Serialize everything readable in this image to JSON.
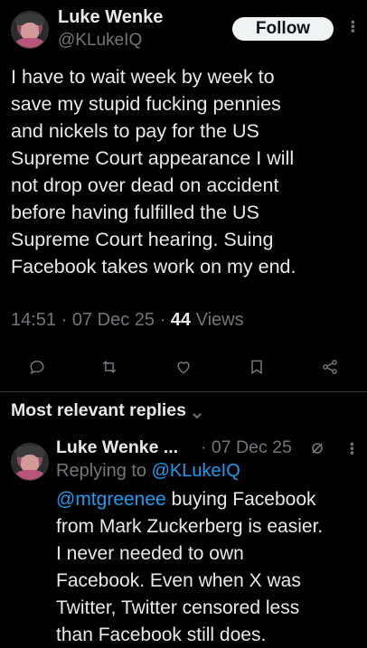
{
  "tweet": {
    "display_name": "Luke Wenke",
    "handle": "@KLukeIQ",
    "follow_label": "Follow",
    "text": "I have to wait week by week to\nsave my stupid fucking pennies\nand nickels to pay for the US\nSupreme Court appearance I will\nnot drop over dead on accident\nbefore having fulfilled the US\nSupreme Court hearing.  Suing\nFacebook takes work on my end.",
    "time": "14:51",
    "sep1": " · ",
    "date": "07 Dec 25",
    "sep2": " · ",
    "views_count": "44",
    "views_label": " Views"
  },
  "actions": [
    "reply-icon",
    "repost-icon",
    "like-icon",
    "bookmark-icon",
    "share-icon"
  ],
  "replies_section": {
    "title": "Most relevant replies"
  },
  "reply": {
    "display_name": "Luke Wenke ...",
    "date": "· 07 Dec 25",
    "replying_prefix": "Replying to ",
    "replying_to": "@KLukeIQ",
    "mention": "@mtgreenee",
    "text_after_mention": " buying Facebook\nfrom Mark Zuckerberg is easier.\nI never needed to own\nFacebook.  Even when X was\nTwitter, Twitter censored less\nthan Facebook still does."
  },
  "colors": {
    "background": "#000000",
    "text": "#e7e9ea",
    "muted": "#71767b",
    "link": "#1d9bf0",
    "follow_button_bg": "#eff3f4"
  }
}
